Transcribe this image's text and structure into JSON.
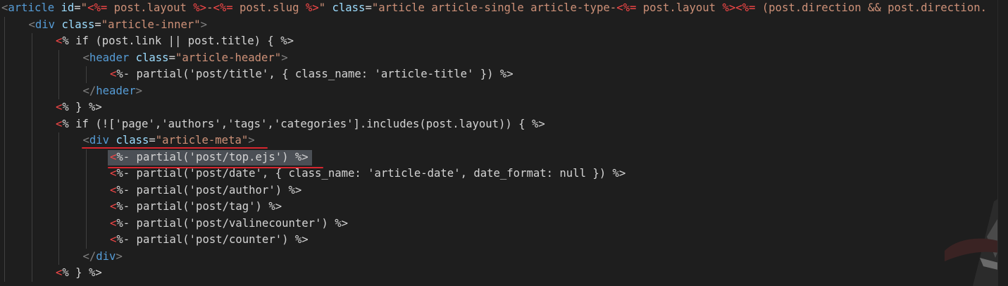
{
  "editor": {
    "theme": "dark",
    "colors": {
      "background": "#1e1e1e",
      "keyword": "#569cd6",
      "attribute": "#9cdcfe",
      "string": "#ce9178",
      "ejs_tag": "#f44747",
      "text": "#d4d4d4",
      "annotation": "#d8262f"
    },
    "lines": [
      {
        "indent": 0,
        "tokens": [
          {
            "t": "<",
            "c": "dim"
          },
          {
            "t": "article",
            "c": "kw"
          },
          {
            "t": " ",
            "c": "txt"
          },
          {
            "t": "id",
            "c": "attr"
          },
          {
            "t": "=",
            "c": "txt"
          },
          {
            "t": "\"",
            "c": "str"
          },
          {
            "t": "<%=",
            "c": "ejs"
          },
          {
            "t": " post.layout ",
            "c": "str"
          },
          {
            "t": "%>",
            "c": "ejs"
          },
          {
            "t": "-",
            "c": "str"
          },
          {
            "t": "<%=",
            "c": "ejs"
          },
          {
            "t": " post.slug ",
            "c": "str"
          },
          {
            "t": "%>",
            "c": "ejs"
          },
          {
            "t": "\"",
            "c": "str"
          },
          {
            "t": " ",
            "c": "txt"
          },
          {
            "t": "class",
            "c": "attr"
          },
          {
            "t": "=",
            "c": "txt"
          },
          {
            "t": "\"article article-single article-type-",
            "c": "str"
          },
          {
            "t": "<%=",
            "c": "ejs"
          },
          {
            "t": " post.layout ",
            "c": "str"
          },
          {
            "t": "%>",
            "c": "ejs"
          },
          {
            "t": "<%=",
            "c": "ejs"
          },
          {
            "t": " (post.direction && post.direction.",
            "c": "str"
          }
        ]
      },
      {
        "indent": 1,
        "tokens": [
          {
            "t": "<",
            "c": "dim"
          },
          {
            "t": "div",
            "c": "kw"
          },
          {
            "t": " ",
            "c": "txt"
          },
          {
            "t": "class",
            "c": "attr"
          },
          {
            "t": "=",
            "c": "txt"
          },
          {
            "t": "\"article-inner\"",
            "c": "str"
          },
          {
            "t": ">",
            "c": "dim"
          }
        ]
      },
      {
        "indent": 2,
        "tokens": [
          {
            "t": "<",
            "c": "ejs"
          },
          {
            "t": "% if (post.link || post.title) { %>",
            "c": "txt"
          }
        ]
      },
      {
        "indent": 3,
        "tokens": [
          {
            "t": "<",
            "c": "dim"
          },
          {
            "t": "header",
            "c": "kw"
          },
          {
            "t": " ",
            "c": "txt"
          },
          {
            "t": "class",
            "c": "attr"
          },
          {
            "t": "=",
            "c": "txt"
          },
          {
            "t": "\"article-header\"",
            "c": "str"
          },
          {
            "t": ">",
            "c": "dim"
          }
        ]
      },
      {
        "indent": 4,
        "tokens": [
          {
            "t": "<",
            "c": "ejs"
          },
          {
            "t": "%- partial('post/title', { class_name: 'article-title' }) %>",
            "c": "txt"
          }
        ]
      },
      {
        "indent": 3,
        "tokens": [
          {
            "t": "</",
            "c": "dim"
          },
          {
            "t": "header",
            "c": "kw"
          },
          {
            "t": ">",
            "c": "dim"
          }
        ]
      },
      {
        "indent": 2,
        "tokens": [
          {
            "t": "<",
            "c": "ejs"
          },
          {
            "t": "% } %>",
            "c": "txt"
          }
        ]
      },
      {
        "indent": 2,
        "tokens": [
          {
            "t": "<",
            "c": "ejs"
          },
          {
            "t": "% if (!['page','authors','tags','categories'].includes(post.layout)) { %>",
            "c": "txt"
          }
        ]
      },
      {
        "indent": 3,
        "tokens": [
          {
            "t": "<",
            "c": "dim"
          },
          {
            "t": "div",
            "c": "kw"
          },
          {
            "t": " ",
            "c": "txt"
          },
          {
            "t": "class",
            "c": "attr"
          },
          {
            "t": "=",
            "c": "txt"
          },
          {
            "t": "\"article-meta\"",
            "c": "str"
          },
          {
            "t": ">",
            "c": "dim"
          }
        ]
      },
      {
        "indent": 4,
        "tokens": [
          {
            "t": "<",
            "c": "ejs"
          },
          {
            "t": "%- partial('post/top.ejs') %>",
            "c": "txt"
          }
        ]
      },
      {
        "indent": 4,
        "tokens": [
          {
            "t": "<",
            "c": "ejs"
          },
          {
            "t": "%- partial('post/date', { class_name: 'article-date', date_format: null }) %>",
            "c": "txt"
          }
        ]
      },
      {
        "indent": 4,
        "tokens": [
          {
            "t": "<",
            "c": "ejs"
          },
          {
            "t": "%- partial('post/author') %>",
            "c": "txt"
          }
        ]
      },
      {
        "indent": 4,
        "tokens": [
          {
            "t": "<",
            "c": "ejs"
          },
          {
            "t": "%- partial('post/tag') %>",
            "c": "txt"
          }
        ]
      },
      {
        "indent": 4,
        "tokens": [
          {
            "t": "<",
            "c": "ejs"
          },
          {
            "t": "%- partial('post/valinecounter') %>",
            "c": "txt"
          }
        ]
      },
      {
        "indent": 4,
        "tokens": [
          {
            "t": "<",
            "c": "ejs"
          },
          {
            "t": "%- partial('post/counter') %>",
            "c": "txt"
          }
        ]
      },
      {
        "indent": 3,
        "tokens": [
          {
            "t": "</",
            "c": "dim"
          },
          {
            "t": "div",
            "c": "kw"
          },
          {
            "t": ">",
            "c": "dim"
          }
        ]
      },
      {
        "indent": 2,
        "tokens": [
          {
            "t": "<",
            "c": "ejs"
          },
          {
            "t": "% } %>",
            "c": "txt"
          }
        ]
      }
    ]
  }
}
